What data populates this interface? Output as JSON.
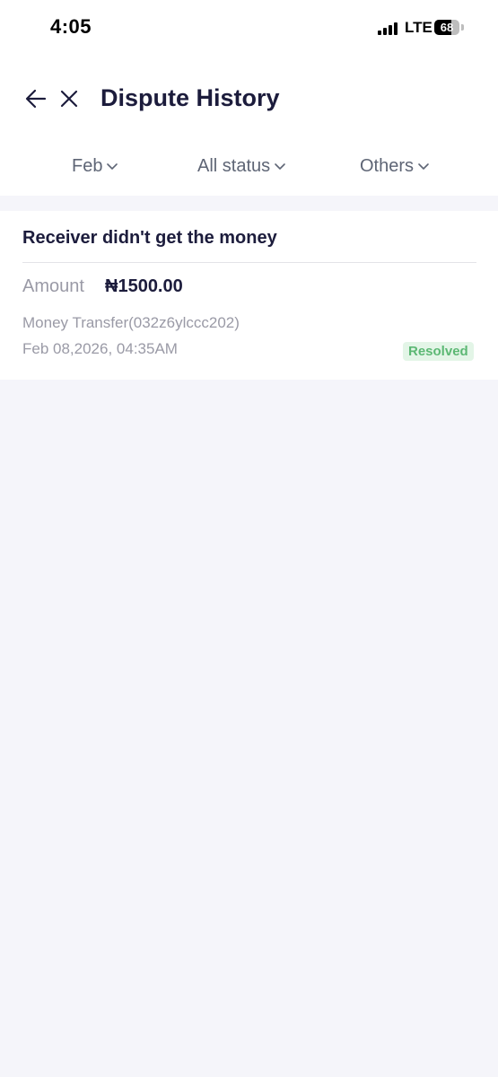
{
  "status_bar": {
    "time": "4:05",
    "network": "LTE",
    "battery_percent": 68,
    "battery_text": "68"
  },
  "header": {
    "title": "Dispute History",
    "back_icon": "arrow-left-icon",
    "close_icon": "close-icon"
  },
  "filters": {
    "month": "Feb",
    "status": "All status",
    "other": "Others",
    "dropdown_icon": "chevron-down-icon"
  },
  "disputes": [
    {
      "title": "Receiver didn't get the money",
      "amount_label": "Amount",
      "amount_value": "₦1500.00",
      "reference": "Money Transfer(032z6ylccc202)",
      "date": "Feb 08,2026, 04:35AM",
      "status": "Resolved"
    }
  ],
  "colors": {
    "page_background": "#f5f5fa",
    "title_text": "#1c1c3c",
    "secondary_text": "#9a9aa6",
    "resolved_text": "#5cb874",
    "resolved_background": "#e3f5e7"
  }
}
